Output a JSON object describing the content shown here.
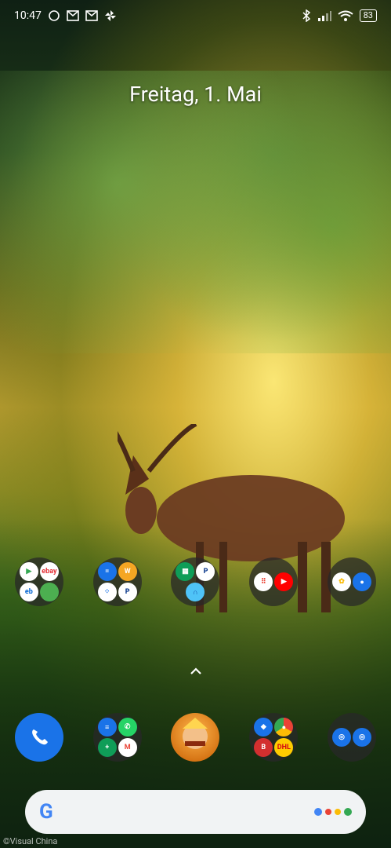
{
  "status_bar": {
    "time": "10:47",
    "battery": "83",
    "left_icons": [
      "whatsapp-icon",
      "gmail-icon",
      "gmail-icon",
      "pinwheel-icon"
    ],
    "right_icons": [
      "bluetooth-icon",
      "signal-icon",
      "wifi-icon"
    ]
  },
  "date": "Freitag, 1. Mai",
  "folders_row": [
    {
      "name": "folder-1",
      "apps": [
        "play-store",
        "ebay",
        "ebay-kleinanzeigen",
        "other"
      ]
    },
    {
      "name": "folder-2",
      "apps": [
        "calculator",
        "weather",
        "dots",
        "paypal"
      ]
    },
    {
      "name": "folder-3",
      "apps": [
        "sheets",
        "paypal",
        "notes"
      ]
    },
    {
      "name": "folder-4",
      "apps": [
        "dialpad",
        "youtube"
      ]
    },
    {
      "name": "folder-5",
      "apps": [
        "photos",
        "profile"
      ]
    }
  ],
  "dock": [
    {
      "name": "phone-app",
      "icon": "phone-icon"
    },
    {
      "name": "messaging-folder",
      "apps": [
        "messages",
        "whatsapp",
        "plus",
        "gmail"
      ]
    },
    {
      "name": "clash-of-clans-app",
      "icon": "game-icon"
    },
    {
      "name": "browser-folder",
      "apps": [
        "maps",
        "chrome",
        "bild",
        "dhl"
      ]
    },
    {
      "name": "camera-folder",
      "apps": [
        "camera",
        "camera"
      ]
    }
  ],
  "search": {
    "g_logo": "G",
    "assistant": "assistant-icon"
  },
  "credit": "©Visual China",
  "colors": {
    "phone_blue": "#1a73e8",
    "paypal_blue": "#003087",
    "youtube_red": "#ff0000",
    "google_blue": "#4285f4",
    "google_red": "#ea4335",
    "google_yellow": "#fbbc05",
    "google_green": "#34a853"
  }
}
